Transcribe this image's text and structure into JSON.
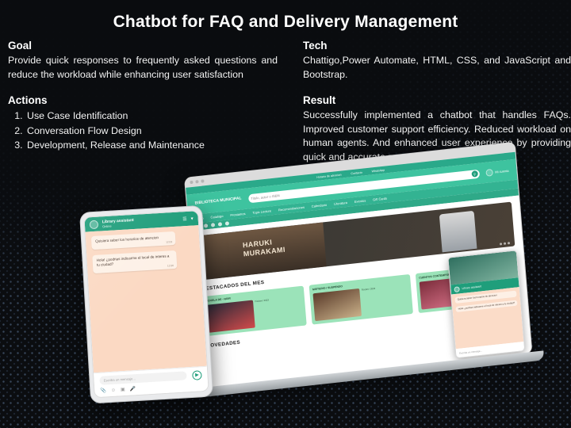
{
  "title": "Chatbot for FAQ and Delivery Management",
  "sections": {
    "goal": {
      "heading": "Goal",
      "body": "Provide quick responses to frequently asked questions and reduce the workload while enhancing user satisfaction"
    },
    "actions": {
      "heading": "Actions",
      "items": [
        "Use Case Identification",
        "Conversation Flow Design",
        "Development, Release and Maintenance"
      ]
    },
    "tech": {
      "heading": "Tech",
      "body": "Chattigo,Power Automate, HTML, CSS, and JavaScript and Bootstrap."
    },
    "result": {
      "heading": "Result",
      "body": "Successfully implemented a chatbot that handles FAQs. Improved customer support efficiency. Reduced workload on human agents. And enhanced user experience by providing quick and accurate responses."
    }
  },
  "phone": {
    "header": {
      "name": "Library assistant",
      "status": "Online",
      "menu_icon": "equalizer-icon",
      "chevron_icon": "chevron-down-icon"
    },
    "messages": [
      {
        "text": "Quisiera saber los horarios de atencion",
        "time": "12:03",
        "side": "left"
      },
      {
        "text": "Hola! ¿podrias indicarme el local de interes a tu ciudad?",
        "time": "12:06",
        "side": "left"
      }
    ],
    "composer": {
      "placeholder": "Escriba un mensaje...",
      "send_icon": "send-icon",
      "attach_icon": "paperclip-icon",
      "emoji_icon": "emoji-icon",
      "mic_icon": "microphone-icon",
      "camera_icon": "camera-icon"
    }
  },
  "browser": {
    "topbar_links": [
      "Horario de atencion",
      "Contacto",
      "WhatsApp"
    ],
    "logo": "BIBLIOTECA MUNICIPAL",
    "search_placeholder": "Titulo, autor o ISBN",
    "search_button_icon": "search-icon",
    "account_label": "Mi cuenta",
    "nav_items": [
      "Inicio",
      "Catalogo",
      "Prestamos",
      "Topic Lecture",
      "Recomendaciones",
      "Calendario",
      "Literatura",
      "Eventos",
      "Gift Cards"
    ],
    "hero": {
      "line1": "HARUKI",
      "line2": "MURAKAMI"
    },
    "section_featured": "DESTACADOS DEL MES",
    "section_news": "NOVEDADES",
    "cards": [
      {
        "title": "NOVELA DE - NOIR",
        "meta": "Ficcion / 2023"
      },
      {
        "title": "MISTERIO / SUSPENSO",
        "meta": "Ficcion / 2023"
      },
      {
        "title": "CUENTOS CONTEMPORANEOS",
        "meta": "Ficcion / 2023"
      }
    ],
    "widget": {
      "name": "Library assistant",
      "status": "Online",
      "messages": [
        "Quisiera saber los horarios de atencion",
        "Hola! ¿podrias indicarme el local de interes a tu ciudad?"
      ],
      "placeholder": "Escriba un mensaje..."
    }
  },
  "colors": {
    "accent_green": "#1f9e7b",
    "header_green": "#3ec39f",
    "chat_bg": "#fbd9c3",
    "background": "#0b0d10"
  }
}
